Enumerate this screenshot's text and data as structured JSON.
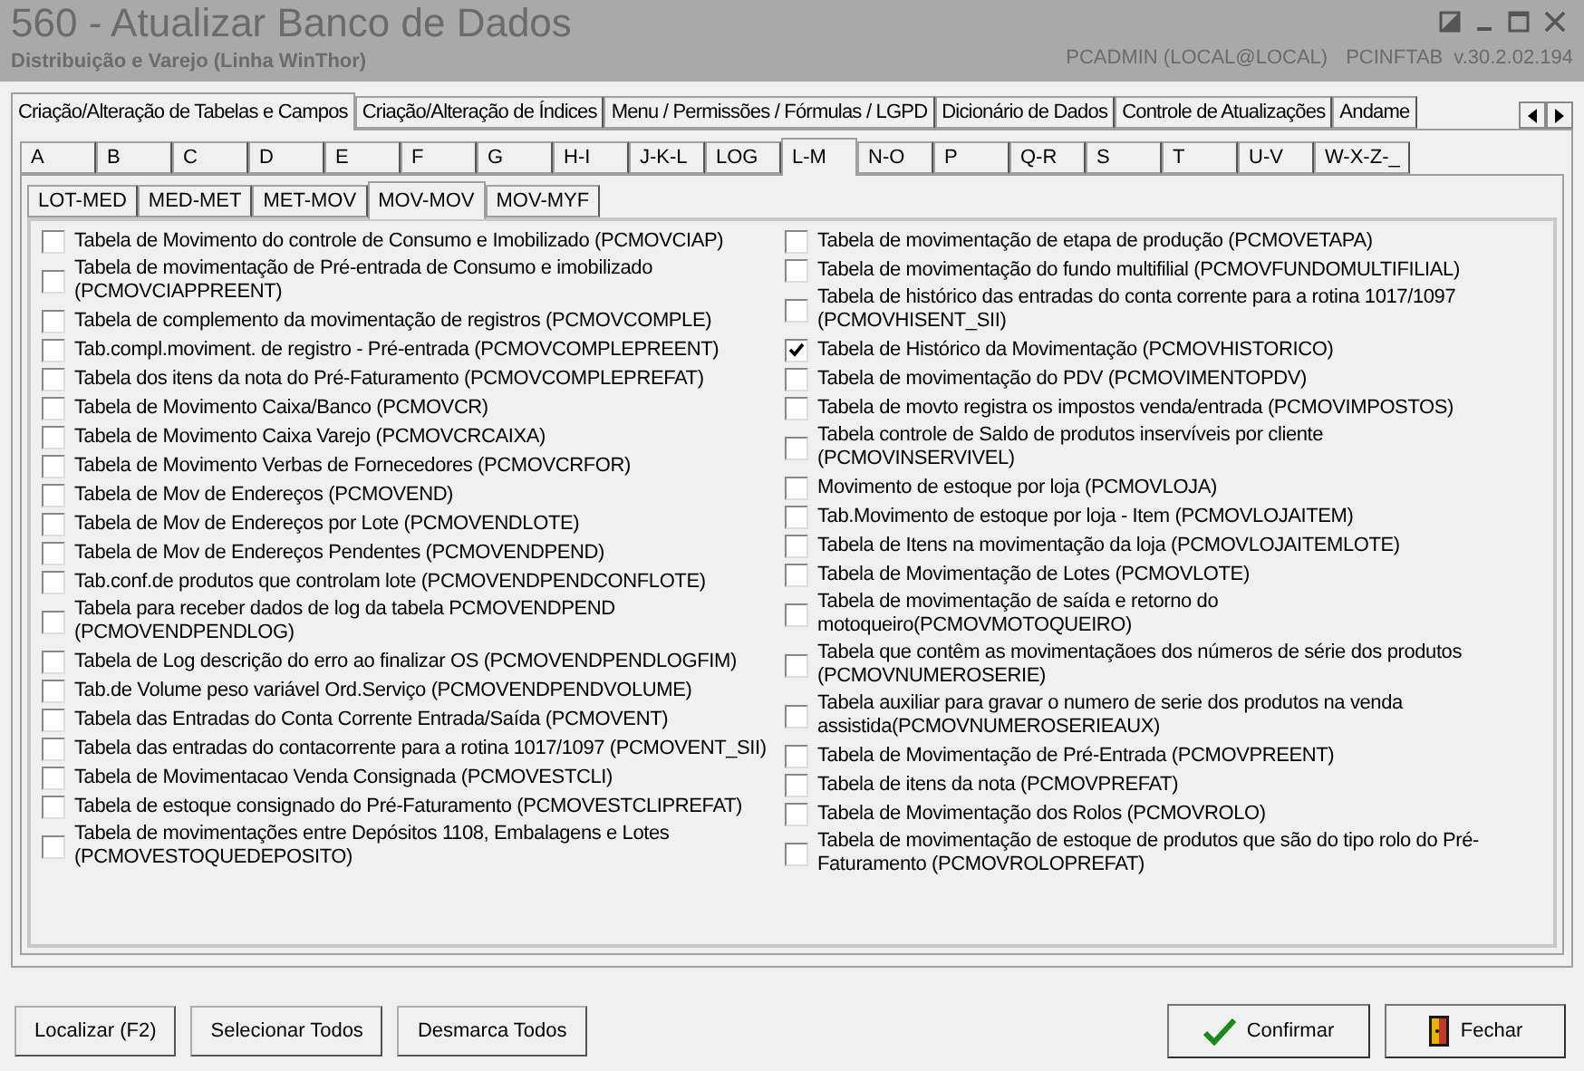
{
  "window": {
    "title": "560 - Atualizar Banco de Dados",
    "subtitle": "Distribuição e Varejo (Linha WinThor)",
    "user": "PCADMIN (LOCAL@LOCAL)",
    "module": "PCINFTAB",
    "version": "v.30.2.02.194"
  },
  "main_tabs": [
    {
      "label": "Criação/Alteração de Tabelas e Campos",
      "selected": true
    },
    {
      "label": "Criação/Alteração de Índices",
      "selected": false
    },
    {
      "label": "Menu / Permissões / Fórmulas / LGPD",
      "selected": false
    },
    {
      "label": "Dicionário de Dados",
      "selected": false
    },
    {
      "label": "Controle de Atualizações",
      "selected": false
    },
    {
      "label": "Andame",
      "selected": false
    }
  ],
  "letter_tabs": [
    {
      "label": "A",
      "selected": false
    },
    {
      "label": "B",
      "selected": false
    },
    {
      "label": "C",
      "selected": false
    },
    {
      "label": "D",
      "selected": false
    },
    {
      "label": "E",
      "selected": false
    },
    {
      "label": "F",
      "selected": false
    },
    {
      "label": "G",
      "selected": false
    },
    {
      "label": "H-I",
      "selected": false
    },
    {
      "label": "J-K-L",
      "selected": false
    },
    {
      "label": "LOG",
      "selected": false
    },
    {
      "label": "L-M",
      "selected": true
    },
    {
      "label": "N-O",
      "selected": false
    },
    {
      "label": "P",
      "selected": false
    },
    {
      "label": "Q-R",
      "selected": false
    },
    {
      "label": "S",
      "selected": false
    },
    {
      "label": "T",
      "selected": false
    },
    {
      "label": "U-V",
      "selected": false
    },
    {
      "label": "W-X-Z-_",
      "selected": false
    }
  ],
  "sub_tabs": [
    {
      "label": "LOT-MED",
      "selected": false
    },
    {
      "label": "MED-MET",
      "selected": false
    },
    {
      "label": "MET-MOV",
      "selected": false
    },
    {
      "label": "MOV-MOV",
      "selected": true
    },
    {
      "label": "MOV-MYF",
      "selected": false
    }
  ],
  "left_tables": [
    {
      "label": "Tabela de Movimento do controle de Consumo e Imobilizado (PCMOVCIAP)",
      "checked": false
    },
    {
      "label": "Tabela de movimentação de Pré-entrada de Consumo e imobilizado (PCMOVCIAPPREENT)",
      "checked": false
    },
    {
      "label": "Tabela de complemento da movimentação de registros (PCMOVCOMPLE)",
      "checked": false
    },
    {
      "label": "Tab.compl.moviment. de registro - Pré-entrada (PCMOVCOMPLEPREENT)",
      "checked": false
    },
    {
      "label": "Tabela dos itens da nota do Pré-Faturamento (PCMOVCOMPLEPREFAT)",
      "checked": false
    },
    {
      "label": "Tabela de Movimento Caixa/Banco (PCMOVCR)",
      "checked": false
    },
    {
      "label": "Tabela de Movimento Caixa Varejo (PCMOVCRCAIXA)",
      "checked": false
    },
    {
      "label": "Tabela de Movimento Verbas de Fornecedores (PCMOVCRFOR)",
      "checked": false
    },
    {
      "label": "Tabela de Mov de Endereços (PCMOVEND)",
      "checked": false
    },
    {
      "label": "Tabela de Mov de Endereços por Lote (PCMOVENDLOTE)",
      "checked": false
    },
    {
      "label": "Tabela de Mov de Endereços Pendentes (PCMOVENDPEND)",
      "checked": false
    },
    {
      "label": "Tab.conf.de produtos que controlam lote (PCMOVENDPENDCONFLOTE)",
      "checked": false
    },
    {
      "label": "Tabela para receber dados de log da tabela PCMOVENDPEND (PCMOVENDPENDLOG)",
      "checked": false
    },
    {
      "label": "Tabela de Log descrição do erro ao finalizar OS (PCMOVENDPENDLOGFIM)",
      "checked": false
    },
    {
      "label": "Tab.de Volume peso variável Ord.Serviço (PCMOVENDPENDVOLUME)",
      "checked": false
    },
    {
      "label": "Tabela das Entradas do Conta Corrente Entrada/Saída (PCMOVENT)",
      "checked": false
    },
    {
      "label": "Tabela das entradas do contacorrente para a rotina 1017/1097 (PCMOVENT_SII)",
      "checked": false
    },
    {
      "label": "Tabela de Movimentacao Venda Consignada (PCMOVESTCLI)",
      "checked": false
    },
    {
      "label": "Tabela de estoque consignado do Pré-Faturamento (PCMOVESTCLIPREFAT)",
      "checked": false
    },
    {
      "label": "Tabela de movimentações entre Depósitos 1108, Embalagens e Lotes (PCMOVESTOQUEDEPOSITO)",
      "checked": false
    }
  ],
  "right_tables": [
    {
      "label": "Tabela de movimentação de etapa de produção (PCMOVETAPA)",
      "checked": false
    },
    {
      "label": "Tabela de movimentação do fundo multifilial (PCMOVFUNDOMULTIFILIAL)",
      "checked": false
    },
    {
      "label": "Tabela de histórico das entradas do conta corrente para a rotina 1017/1097 (PCMOVHISENT_SII)",
      "checked": false
    },
    {
      "label": "Tabela de Histórico da Movimentação (PCMOVHISTORICO)",
      "checked": true
    },
    {
      "label": "Tabela de movimentação do PDV (PCMOVIMENTOPDV)",
      "checked": false
    },
    {
      "label": "Tabela de movto registra os impostos venda/entrada (PCMOVIMPOSTOS)",
      "checked": false
    },
    {
      "label": "Tabela controle de Saldo de produtos inservíveis por cliente (PCMOVINSERVIVEL)",
      "checked": false
    },
    {
      "label": "Movimento de estoque por loja (PCMOVLOJA)",
      "checked": false
    },
    {
      "label": "Tab.Movimento de estoque por loja - Item (PCMOVLOJAITEM)",
      "checked": false
    },
    {
      "label": "Tabela de Itens na movimentação da loja (PCMOVLOJAITEMLOTE)",
      "checked": false
    },
    {
      "label": "Tabela de Movimentação de Lotes (PCMOVLOTE)",
      "checked": false
    },
    {
      "label": "Tabela de movimentação de saída e retorno do motoqueiro(PCMOVMOTOQUEIRO)",
      "checked": false
    },
    {
      "label": "Tabela que contêm as movimentaçãoes dos números de série dos produtos (PCMOVNUMEROSERIE)",
      "checked": false
    },
    {
      "label": "Tabela auxiliar para gravar o numero de serie dos produtos na venda assistida(PCMOVNUMEROSERIEAUX)",
      "checked": false
    },
    {
      "label": "Tabela de Movimentação de Pré-Entrada (PCMOVPREENT)",
      "checked": false
    },
    {
      "label": "Tabela de itens da nota (PCMOVPREFAT)",
      "checked": false
    },
    {
      "label": "Tabela de Movimentação dos Rolos (PCMOVROLO)",
      "checked": false
    },
    {
      "label": "Tabela de movimentação de estoque de produtos que são do tipo rolo do Pré-Faturamento (PCMOVROLOPREFAT)",
      "checked": false
    }
  ],
  "left_buttons": [
    "Localizar (F2)",
    "Selecionar Todos",
    "Desmarca Todos"
  ],
  "right_buttons": [
    {
      "label": "Confirmar",
      "kind": "confirm"
    },
    {
      "label": "Fechar",
      "kind": "close"
    }
  ]
}
